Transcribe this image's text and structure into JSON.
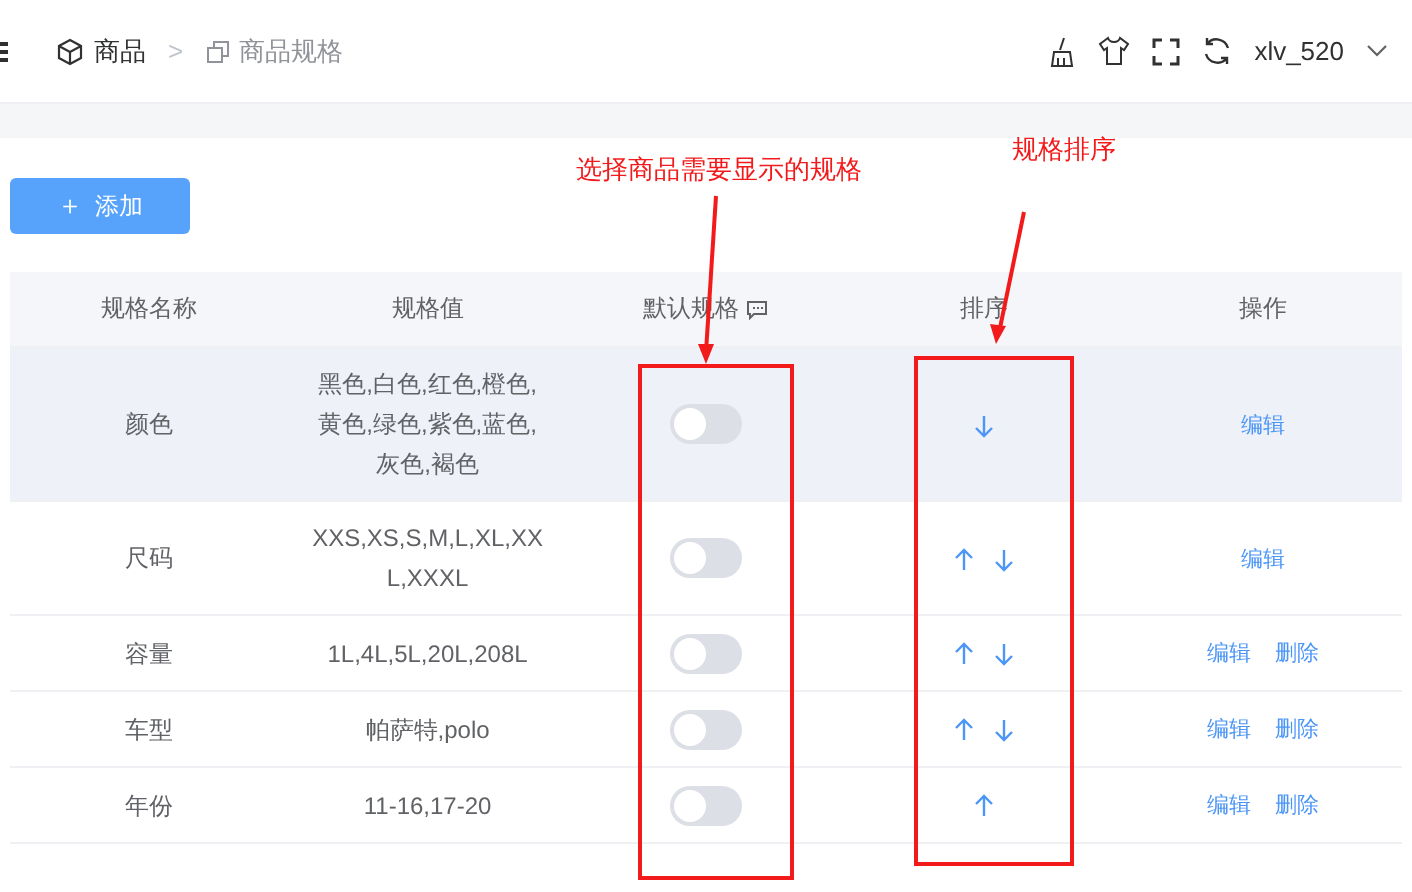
{
  "breadcrumb": [
    {
      "label": "商品"
    },
    {
      "label": ">"
    },
    {
      "label": "商品规格"
    }
  ],
  "user": {
    "name": "xlv_520"
  },
  "add_button": {
    "label": "添加",
    "icon": "＋"
  },
  "table": {
    "columns": [
      "规格名称",
      "规格值",
      "默认规格",
      "排序",
      "操作"
    ],
    "rows": [
      {
        "name": "颜色",
        "values": "黑色,白色,红色,橙色,黄色,绿色,紫色,蓝色,灰色,褐色",
        "default_on": false,
        "up": false,
        "down": true,
        "actions": [
          "编辑"
        ],
        "highlighted": true
      },
      {
        "name": "尺码",
        "values": "XXS,XS,S,M,L,XL,XXL,XXXL",
        "default_on": false,
        "up": true,
        "down": true,
        "actions": [
          "编辑"
        ],
        "highlighted": false
      },
      {
        "name": "容量",
        "values": "1L,4L,5L,20L,208L",
        "default_on": false,
        "up": true,
        "down": true,
        "actions": [
          "编辑",
          "删除"
        ],
        "highlighted": false
      },
      {
        "name": "车型",
        "values": "帕萨特,polo",
        "default_on": false,
        "up": true,
        "down": true,
        "actions": [
          "编辑",
          "删除"
        ],
        "highlighted": false
      },
      {
        "name": "年份",
        "values": "11-16,17-20",
        "default_on": false,
        "up": true,
        "down": false,
        "actions": [
          "编辑",
          "删除"
        ],
        "highlighted": false
      }
    ]
  },
  "annotations": [
    {
      "text": "选择商品需要显示的规格"
    },
    {
      "text": "规格排序"
    }
  ]
}
